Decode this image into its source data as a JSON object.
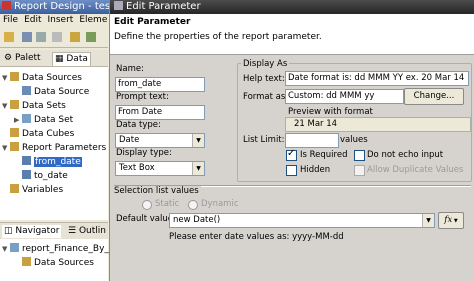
{
  "background": {
    "title": "Report Design - test",
    "menu": [
      "File",
      "Edit",
      "Insert",
      "Eleme"
    ],
    "palette_tabs": [
      "Palett",
      "Data"
    ],
    "tree": [
      {
        "label": "Data Sources",
        "level": 1,
        "expanded": true
      },
      {
        "label": "Data Source",
        "level": 2
      },
      {
        "label": "Data Sets",
        "level": 1,
        "expanded": true
      },
      {
        "label": "Data Set",
        "level": 2,
        "collapsed": true
      },
      {
        "label": "Data Cubes",
        "level": 1
      },
      {
        "label": "Report Parameters",
        "level": 1,
        "expanded": true
      },
      {
        "label": "from_date",
        "level": 2,
        "selected": true
      },
      {
        "label": "to_date",
        "level": 2
      },
      {
        "label": "Variables",
        "level": 1
      }
    ],
    "nav_tabs": [
      "Navigator",
      "Outlin"
    ],
    "nav_tree": [
      "report_Finance_By_",
      "Data Sources"
    ]
  },
  "dialog": {
    "title": "Edit Parameter",
    "header_title": "Edit Parameter",
    "header_desc": "Define the properties of the report parameter.",
    "name_label": "Name:",
    "name_value": "from_date",
    "prompt_label": "Prompt text:",
    "prompt_value": "From Date",
    "data_type_label": "Data type:",
    "data_type_value": "Date",
    "display_type_label": "Display type:",
    "display_type_value": "Text Box",
    "display_as_title": "Display As",
    "help_text_label": "Help text:",
    "help_text_value": "Date format is: dd MMM YY ex. 20 Mar 14",
    "format_as_label": "Format as:",
    "format_as_value": "Custom: dd MMM yy",
    "change_button": "Change...",
    "preview_label": "Preview with format",
    "preview_value": "21 Mar 14",
    "list_limit_label": "List Limit:",
    "list_limit_value": "",
    "values_label": "values",
    "is_required_label": "Is Required",
    "is_required_checked": true,
    "do_not_echo_label": "Do not echo input",
    "do_not_echo_checked": false,
    "hidden_label": "Hidden",
    "hidden_checked": false,
    "allow_duplicate_label": "Allow Duplicate Values",
    "selection_title": "Selection list values",
    "static_label": "Static",
    "dynamic_label": "Dynamic",
    "default_value_label": "Default value:",
    "default_value": "new Date()",
    "fx_label": "fx",
    "hint": "Please enter date values as: yyyy-MM-dd"
  },
  "colors": {
    "selection": "#316ac5",
    "dialog_title": "#262626",
    "dialog_bg": "#d6d3ce"
  }
}
